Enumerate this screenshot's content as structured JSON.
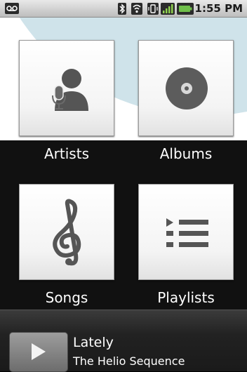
{
  "status_bar": {
    "time": "1:55 PM",
    "icons": [
      "voicemail-icon",
      "bluetooth-icon",
      "wifi-icon",
      "vibrate-icon",
      "signal-icon",
      "battery-icon"
    ]
  },
  "library": {
    "tiles": [
      {
        "label": "Artists",
        "icon": "artist-microphone-icon"
      },
      {
        "label": "Albums",
        "icon": "album-disc-icon"
      },
      {
        "label": "Songs",
        "icon": "treble-clef-icon"
      },
      {
        "label": "Playlists",
        "icon": "playlist-icon"
      }
    ]
  },
  "now_playing": {
    "title": "Lately",
    "artist": "The Helio Sequence",
    "play_icon": "play-icon"
  },
  "colors": {
    "background": "#000000",
    "tile": "#f4f4f4",
    "wallpaper_arc": "#cfe3ea"
  }
}
